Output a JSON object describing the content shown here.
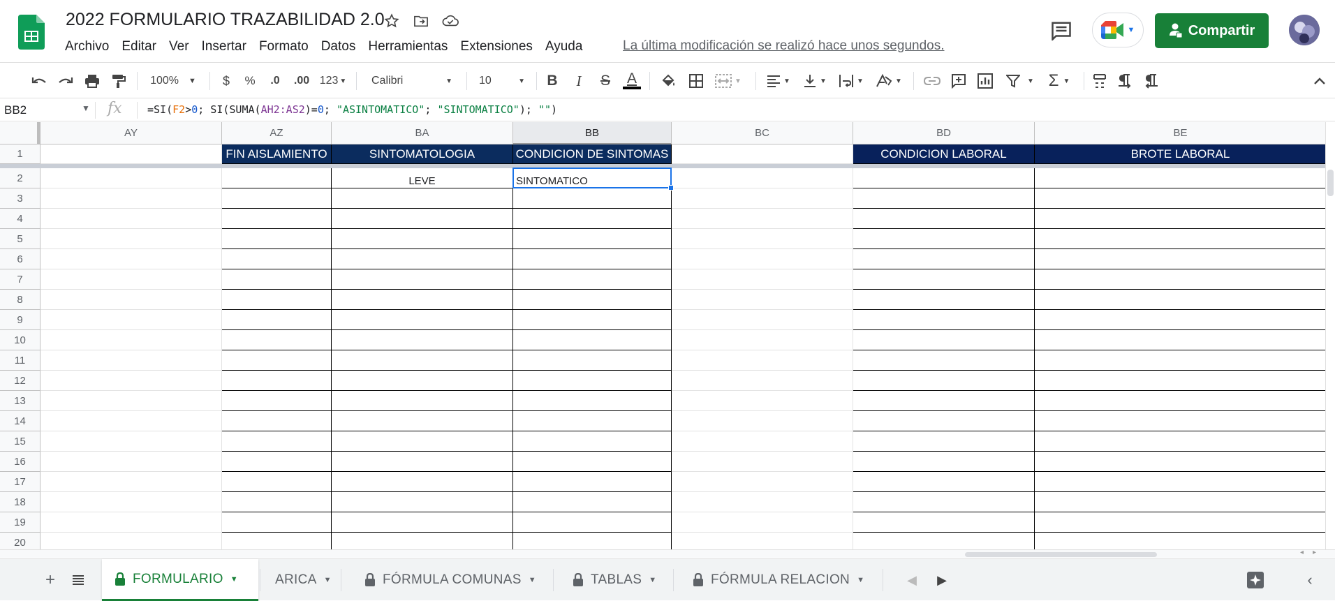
{
  "app": {
    "doc_title": "2022 FORMULARIO TRAZABILIDAD 2.0",
    "last_edit": "La última modificación se realizó hace unos segundos.",
    "share_label": "Compartir"
  },
  "menu": [
    "Archivo",
    "Editar",
    "Ver",
    "Insertar",
    "Formato",
    "Datos",
    "Herramientas",
    "Extensiones",
    "Ayuda"
  ],
  "toolbar": {
    "zoom": "100%",
    "currency": "$",
    "percent": "%",
    "dec_decrease": ".0",
    "dec_increase": ".00",
    "more_formats": "123",
    "font": "Calibri",
    "font_size": "10",
    "bold": "B",
    "italic": "I",
    "strike": "S",
    "text_color": "A",
    "sum": "Σ"
  },
  "formula_bar": {
    "cell_ref": "BB2",
    "fx": "fx",
    "parts": [
      {
        "t": "=SI(",
        "c": "plain"
      },
      {
        "t": "F2",
        "c": "ref1"
      },
      {
        "t": ">",
        "c": "plain"
      },
      {
        "t": "0",
        "c": "num"
      },
      {
        "t": "; SI(SUMA(",
        "c": "plain"
      },
      {
        "t": "AH2:AS2",
        "c": "ref2"
      },
      {
        "t": ")=",
        "c": "plain"
      },
      {
        "t": "0",
        "c": "num"
      },
      {
        "t": "; ",
        "c": "plain"
      },
      {
        "t": "\"ASINTOMATICO\"",
        "c": "str"
      },
      {
        "t": "; ",
        "c": "plain"
      },
      {
        "t": "\"SINTOMATICO\"",
        "c": "str"
      },
      {
        "t": "); ",
        "c": "plain"
      },
      {
        "t": "\"\"",
        "c": "str"
      },
      {
        "t": ")",
        "c": "plain"
      }
    ]
  },
  "columns": [
    "AY",
    "AZ",
    "BA",
    "BB",
    "BC",
    "BD",
    "BE"
  ],
  "selected_column": "BB",
  "header_row": {
    "AZ": "FIN AISLAMIENTO",
    "BA": "SINTOMATOLOGIA",
    "BB": "CONDICION DE SINTOMAS",
    "BD": "CONDICION LABORAL",
    "BE": "BROTE LABORAL"
  },
  "row2": {
    "BA": "LEVE",
    "BB": "SINTOMATICO"
  },
  "rows": [
    "1",
    "2",
    "3",
    "4",
    "5",
    "6",
    "7",
    "8",
    "9",
    "10",
    "11",
    "12",
    "13",
    "14",
    "15",
    "16",
    "17",
    "18",
    "19",
    "20"
  ],
  "sheets": [
    {
      "name": "FORMULARIO",
      "locked": true,
      "active": true
    },
    {
      "name": "ARICA",
      "locked": false,
      "active": false
    },
    {
      "name": "FÓRMULA COMUNAS",
      "locked": true,
      "active": false
    },
    {
      "name": "TABLAS",
      "locked": true,
      "active": false
    },
    {
      "name": "FÓRMULA RELACION",
      "locked": true,
      "active": false
    }
  ],
  "colors": {
    "share_green": "#188038",
    "header_navy": "#0b2c5e",
    "selection_blue": "#1a73e8"
  }
}
